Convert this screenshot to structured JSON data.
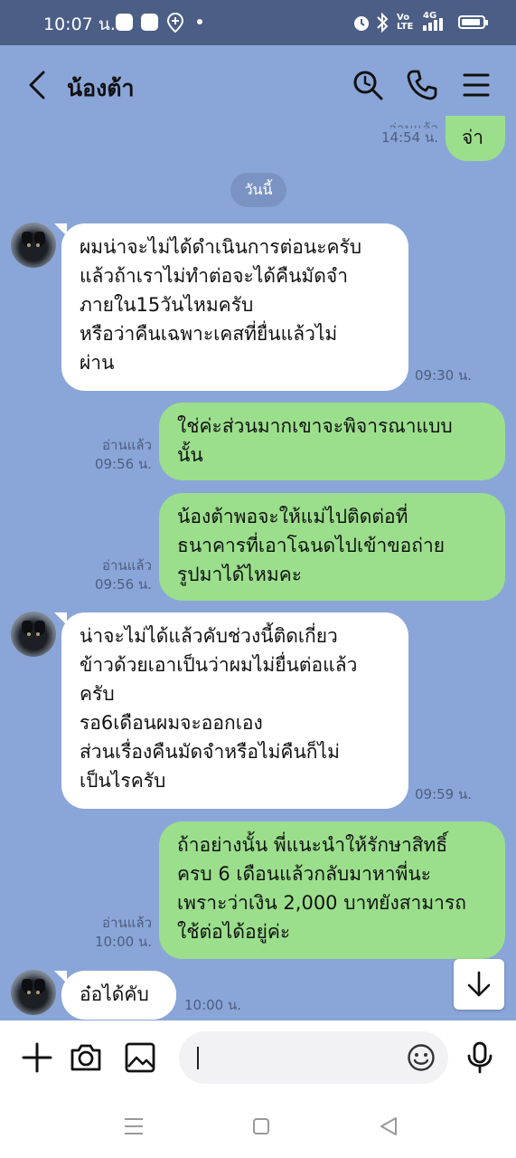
{
  "status_bar": {
    "time": "10:07 น.",
    "network": "4G",
    "icons": [
      "app-icon-1",
      "app-icon-2",
      "location-icon",
      "dot",
      "alarm-icon",
      "bluetooth-icon",
      "volte-icon",
      "signal-icon",
      "battery-icon"
    ]
  },
  "header": {
    "title": "น้องต้า",
    "icons": [
      "back-icon",
      "search-icon",
      "phone-icon",
      "menu-icon"
    ]
  },
  "date_divider": "วันนี้",
  "messages": [
    {
      "side": "out",
      "lines": [
        "จ่า"
      ],
      "read": "อ่านแล้ว",
      "time": "14:54 น."
    },
    {
      "side": "in",
      "lines": [
        "ผมน่าจะไม่ได้ดำเนินการต่อนะครับ",
        "แล้วถ้าเราไม่ทำต่อจะได้คืนมัดจำ",
        "ภายใน15วันไหมครับ",
        "หรือว่าคืนเฉพาะเคสที่ยื่นแล้วไม่",
        "ผ่าน"
      ],
      "time": "09:30 น."
    },
    {
      "side": "out",
      "lines": [
        "ใช่ค่ะส่วนมากเขาจะพิจารณาแบบ",
        "นั้น"
      ],
      "read": "อ่านแล้ว",
      "time": "09:56 น."
    },
    {
      "side": "out",
      "lines": [
        "น้องต้าพอจะให้แม่ไปติดต่อที่",
        "ธนาคารที่เอาโฉนดไปเข้าขอถ่าย",
        "รูปมาได้ไหมคะ"
      ],
      "read": "อ่านแล้ว",
      "time": "09:56 น."
    },
    {
      "side": "in",
      "lines": [
        "น่าจะไม่ได้แล้วคับช่วงนี้ติดเกี่ยว",
        "ข้าวด้วยเอาเป็นว่าผมไม่ยื่นต่อแล้ว",
        "ครับ",
        "รอ6เดือนผมจะออกเอง",
        "ส่วนเรื่องคืนมัดจำหรือไม่คืนก็ไม่",
        "เป็นไรครับ"
      ],
      "time": "09:59 น."
    },
    {
      "side": "out",
      "lines": [
        "ถ้าอย่างนั้น พี่แนะนำให้รักษาสิทธิ์",
        "ครบ 6 เดือนแล้วกลับมาหาพี่นะ",
        "เพราะว่าเงิน 2,000 บาทยังสามารถ",
        "ใช้ต่อได้อยู่ค่ะ"
      ],
      "read": "อ่านแล้ว",
      "time": "10:00 น."
    },
    {
      "side": "in",
      "lines": [
        "อ๋อได้คับ"
      ],
      "time": "10:00 น."
    }
  ],
  "composer": {
    "input_value": "",
    "icons": [
      "plus-icon",
      "camera-icon",
      "image-icon",
      "emoji-icon",
      "microphone-icon"
    ]
  },
  "colors": {
    "chat_background": "#8aa6d8",
    "status_bar": "#4b5e86",
    "outgoing_bubble": "#9bdf8c",
    "incoming_bubble": "#ffffff",
    "meta_text": "#4c5e80"
  }
}
